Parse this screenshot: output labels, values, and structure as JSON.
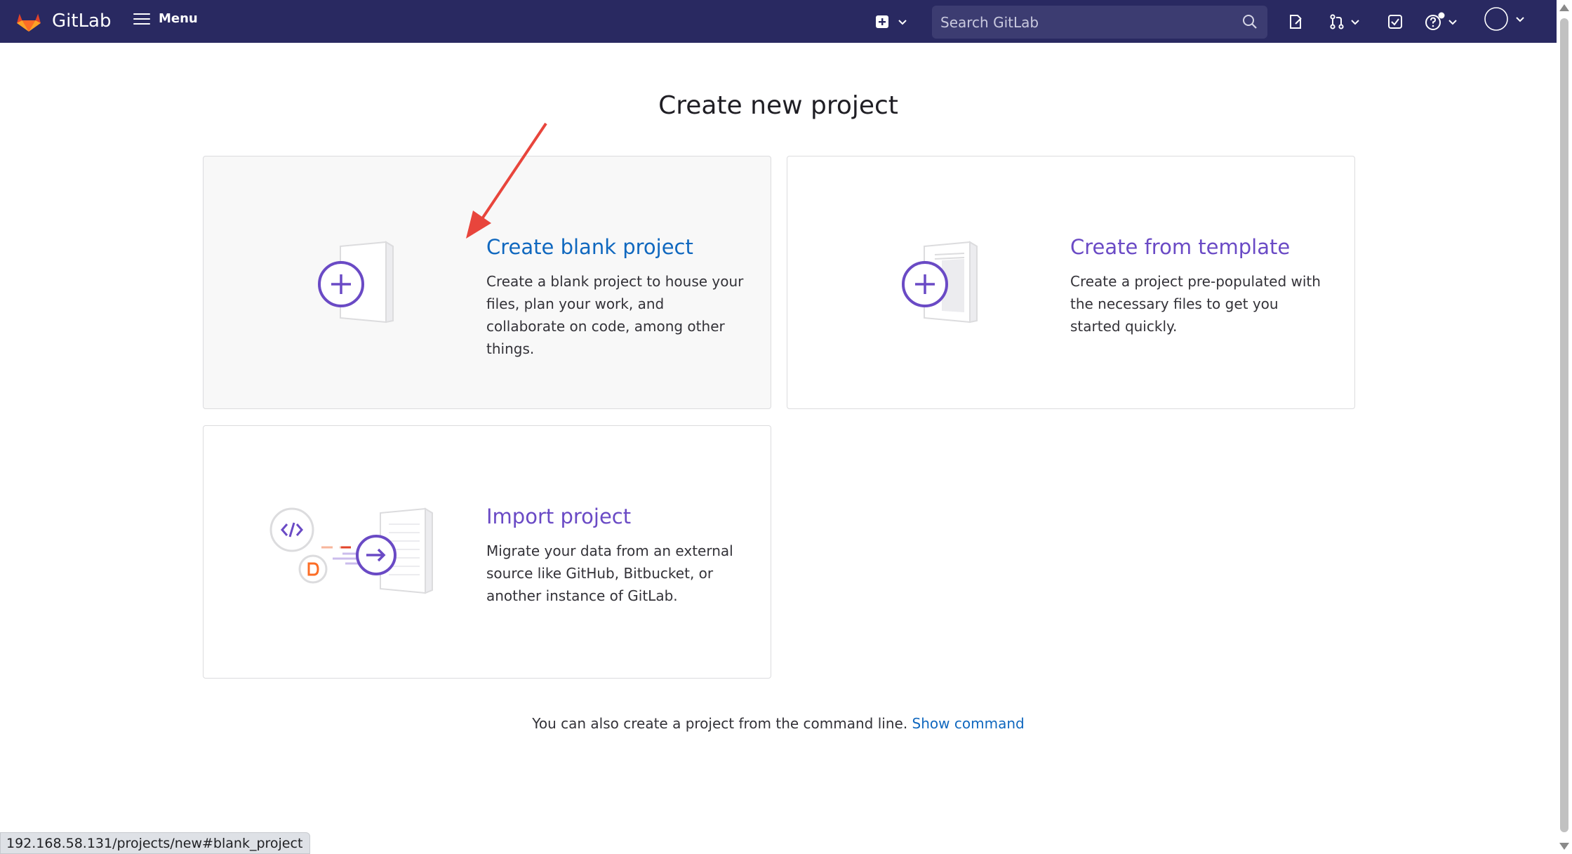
{
  "navbar": {
    "brand": "GitLab",
    "menu_label": "Menu",
    "search": {
      "placeholder": "Search GitLab",
      "value": ""
    },
    "icons": [
      "gitlab-logo-icon",
      "hamburger-icon",
      "new-item-icon",
      "search-icon",
      "issues-icon",
      "merge-requests-icon",
      "todos-icon",
      "help-icon",
      "avatar"
    ],
    "background_color": "#292961"
  },
  "page": {
    "title": "Create new project"
  },
  "cards": [
    {
      "title": "Create blank project",
      "description": "Create a blank project to house your files, plan your work, and collaborate on code, among other things.",
      "state": "hovered"
    },
    {
      "title": "Create from template",
      "description": "Create a project pre-populated with the necessary files to get you started quickly."
    },
    {
      "title": "Import project",
      "description": "Migrate your data from an external source like GitHub, Bitbucket, or another instance of GitLab."
    }
  ],
  "footer": {
    "text": "You can also create a project from the command line.",
    "link": "Show command"
  },
  "status_bar": {
    "url": "192.168.58.131/projects/new#blank_project"
  },
  "colors": {
    "accent_purple": "#6a4ac5",
    "link_blue": "#1068bf",
    "annotation_red": "#e8453c"
  }
}
